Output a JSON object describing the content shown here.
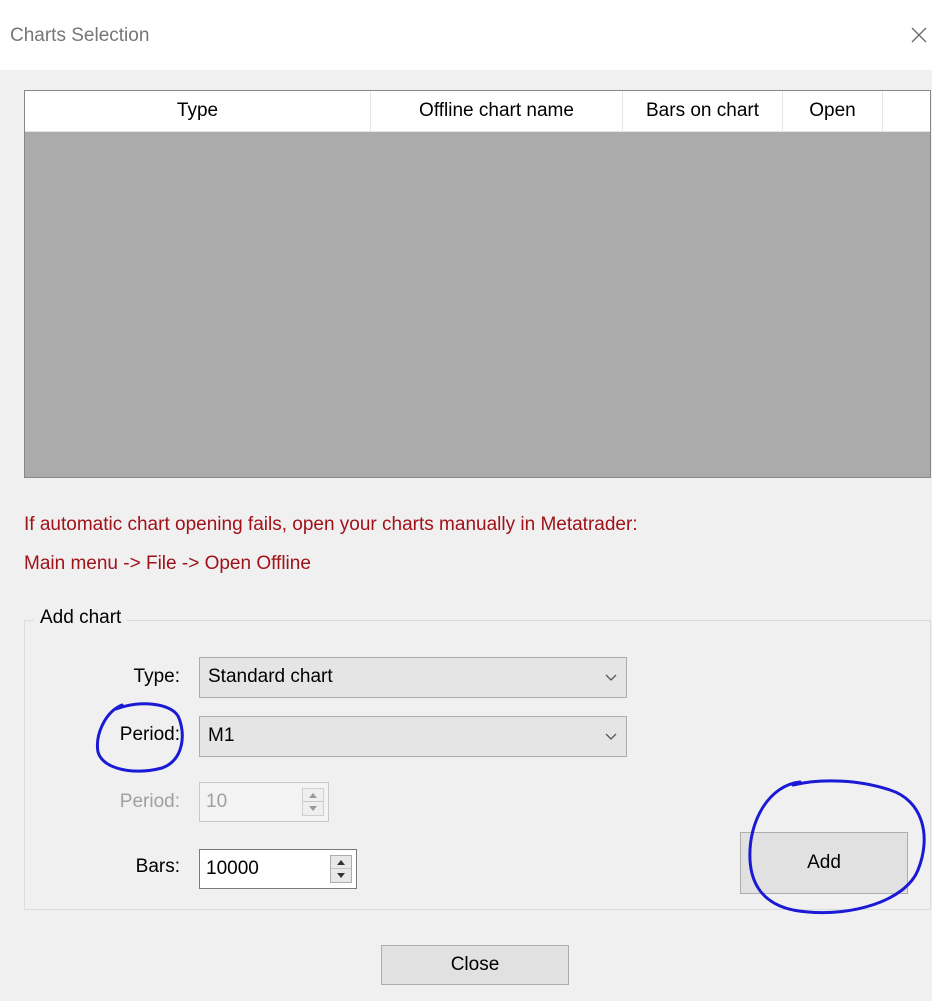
{
  "window": {
    "title": "Charts Selection",
    "close_icon": "close-icon"
  },
  "table": {
    "columns": [
      "Type",
      "Offline chart name",
      "Bars on chart",
      "Open"
    ],
    "rows": []
  },
  "hint": {
    "line1": "If automatic chart opening fails, open your charts manually in Metatrader:",
    "line2": "Main menu -> File -> Open Offline",
    "color": "#a0111a"
  },
  "add_chart": {
    "group_label": "Add chart",
    "type_label": "Type:",
    "type_value": "Standard chart",
    "period_label": "Period:",
    "period_value": "M1",
    "period2_label": "Period:",
    "period2_value": "10",
    "bars_label": "Bars:",
    "bars_value": "10000",
    "add_button": "Add"
  },
  "footer": {
    "close_button": "Close"
  },
  "annotations": {
    "color": "#1a1ad6",
    "circled": [
      "Period label",
      "Add button"
    ]
  }
}
